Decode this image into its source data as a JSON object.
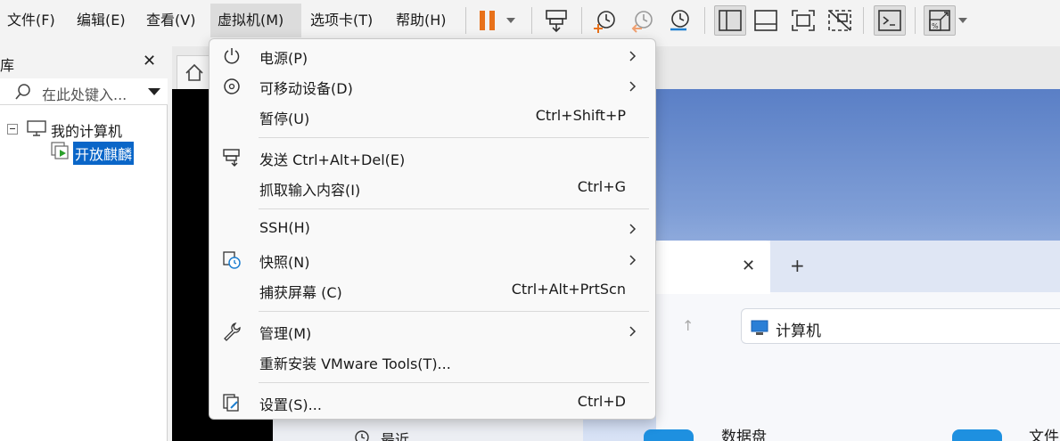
{
  "menubar": {
    "items": [
      {
        "label": "文件(F)",
        "active": false
      },
      {
        "label": "编辑(E)",
        "active": false
      },
      {
        "label": "查看(V)",
        "active": false
      },
      {
        "label": "虚拟机(M)",
        "active": true
      },
      {
        "label": "选项卡(T)",
        "active": false
      },
      {
        "label": "帮助(H)",
        "active": false
      }
    ]
  },
  "toolbar": {
    "accent_color": "#e8711a",
    "icons": [
      "pause-icon",
      "send-ctrl-alt-del-icon",
      "snapshot-take-icon",
      "snapshot-revert-icon",
      "snapshot-manager-icon",
      "library-view-icon",
      "thumbnail-bar-icon",
      "fullscreen-icon",
      "unity-icon",
      "console-icon",
      "stretch-icon"
    ]
  },
  "library": {
    "title": "库",
    "close": "✕",
    "search_placeholder": "在此处键入...",
    "tree": {
      "root": "我的计算机",
      "child": "开放麒麟"
    }
  },
  "vm_menu": {
    "items": [
      {
        "label": "电源(P)",
        "shortcut": "",
        "submenu": true,
        "icon": "power-icon"
      },
      {
        "label": "可移动设备(D)",
        "shortcut": "",
        "submenu": true,
        "icon": "removable-device-icon"
      },
      {
        "label": "暂停(U)",
        "shortcut": "Ctrl+Shift+P",
        "submenu": false,
        "icon": ""
      },
      {
        "label": "发送 Ctrl+Alt+Del(E)",
        "shortcut": "",
        "submenu": false,
        "icon": "send-keys-icon"
      },
      {
        "label": "抓取输入内容(I)",
        "shortcut": "Ctrl+G",
        "submenu": false,
        "icon": ""
      },
      {
        "label": "SSH(H)",
        "shortcut": "",
        "submenu": true,
        "icon": ""
      },
      {
        "label": "快照(N)",
        "shortcut": "",
        "submenu": true,
        "icon": "snapshot-icon"
      },
      {
        "label": "捕获屏幕 (C)",
        "shortcut": "Ctrl+Alt+PrtScn",
        "submenu": false,
        "icon": ""
      },
      {
        "label": "管理(M)",
        "shortcut": "",
        "submenu": true,
        "icon": "wrench-icon"
      },
      {
        "label": "重新安装 VMware Tools(T)...",
        "shortcut": "",
        "submenu": false,
        "icon": ""
      },
      {
        "label": "设置(S)...",
        "shortcut": "Ctrl+D",
        "submenu": false,
        "icon": "settings-icon"
      }
    ]
  },
  "guest": {
    "fm_close": "✕",
    "fm_new_tab": "+",
    "fm_up": "↑",
    "address": "计算机",
    "sidebar_item": "最近",
    "drives": [
      "数据盘",
      "文件"
    ]
  }
}
